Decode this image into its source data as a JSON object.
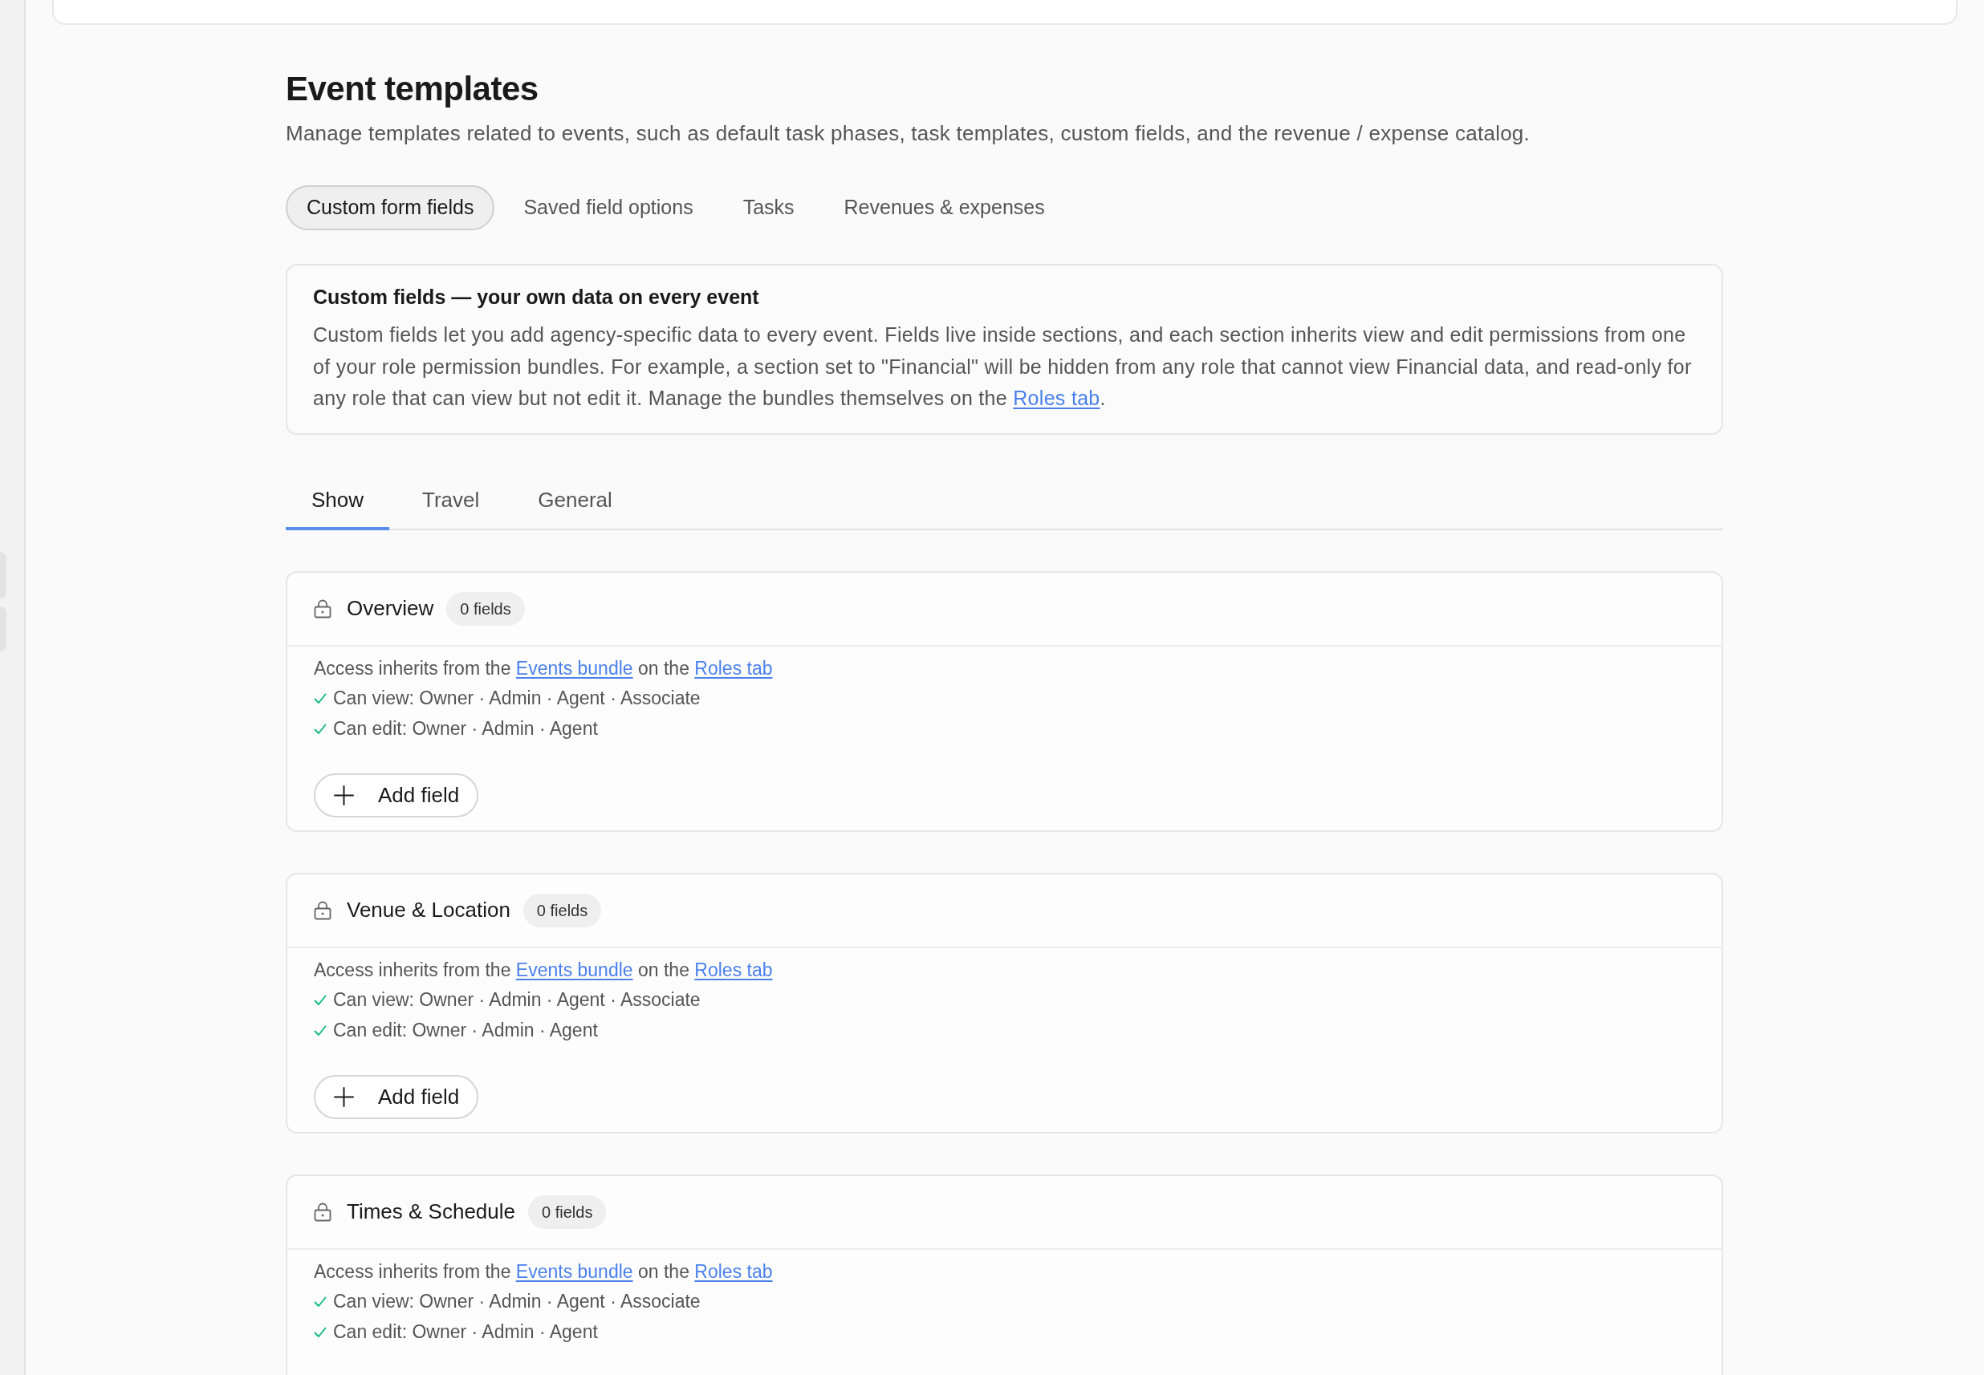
{
  "page": {
    "title": "Event templates",
    "description": "Manage templates related to events, such as default task phases, task templates, custom fields, and the revenue / expense catalog."
  },
  "tabs": [
    {
      "label": "Custom form fields",
      "selected": true
    },
    {
      "label": "Saved field options",
      "selected": false
    },
    {
      "label": "Tasks",
      "selected": false
    },
    {
      "label": "Revenues & expenses",
      "selected": false
    }
  ],
  "info_card": {
    "title": "Custom fields — your own data on every event",
    "text": "Custom fields let you add agency-specific data to every event. Fields live inside sections, and each section inherits view and edit permissions from one of your role permission bundles. For example, a section set to \"Financial\" will be hidden from any role that cannot view Financial data, and read-only for any role that can view but not edit it. Manage the bundles themselves on the",
    "link": "Roles tab",
    "text_end": "."
  },
  "section_tabs": [
    {
      "label": "Show",
      "selected": true
    },
    {
      "label": "Travel",
      "selected": false
    },
    {
      "label": "General",
      "selected": false
    }
  ],
  "sections": [
    {
      "title": "Overview",
      "count": "0 fields",
      "access": {
        "before": "Access inherits from the",
        "bundle_link": "Events bundle",
        "middle": "on the",
        "roles_link": "Roles tab"
      },
      "permissions": [
        "Can view: Owner · Admin · Agent · Associate",
        "Can edit: Owner · Admin · Agent"
      ],
      "add_button": "Add field"
    },
    {
      "title": "Venue & Location",
      "count": "0 fields",
      "access": {
        "before": "Access inherits from the",
        "bundle_link": "Events bundle",
        "middle": "on the",
        "roles_link": "Roles tab"
      },
      "permissions": [
        "Can view: Owner · Admin · Agent · Associate",
        "Can edit: Owner · Admin · Agent"
      ],
      "add_button": "Add field"
    },
    {
      "title": "Times & Schedule",
      "count": "0 fields",
      "access": {
        "before": "Access inherits from the",
        "bundle_link": "Events bundle",
        "middle": "on the",
        "roles_link": "Roles tab"
      },
      "permissions": [
        "Can view: Owner · Admin · Agent · Associate",
        "Can edit: Owner · Admin · Agent"
      ]
    }
  ]
}
